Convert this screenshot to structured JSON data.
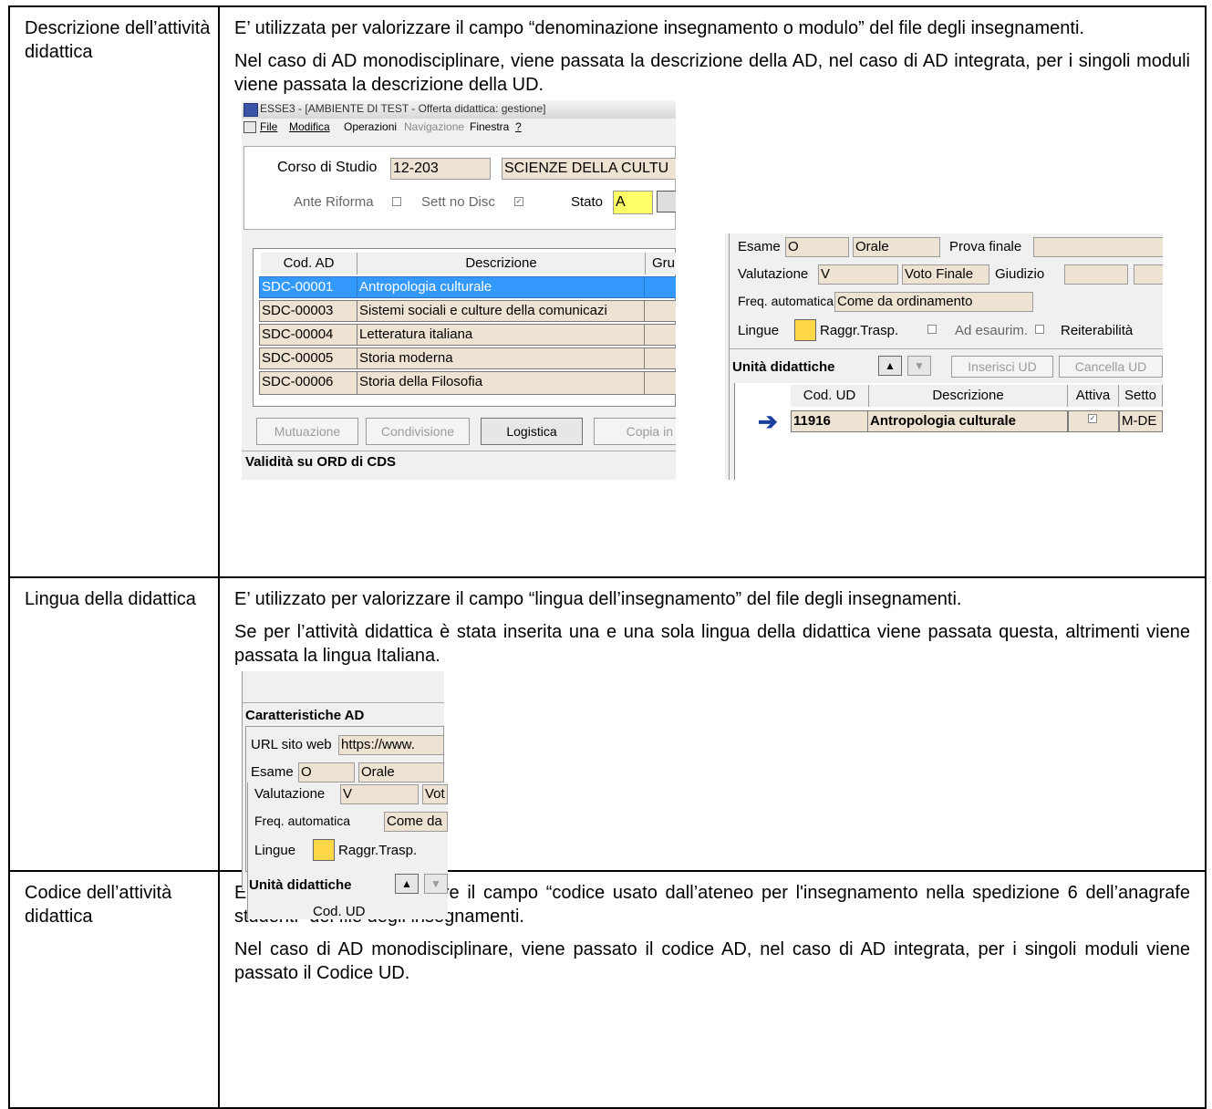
{
  "rows": [
    {
      "label": "Descrizione dell’attività didattica",
      "paragraphs": [
        "E’ utilizzata per valorizzare il campo “denominazione insegnamento o modulo” del file degli insegnamenti.",
        "Nel caso di AD monodisciplinare, viene passata la descrizione della AD, nel caso di AD integrata, per i singoli moduli viene passata la descrizione della UD."
      ]
    },
    {
      "label": "Lingua della didattica",
      "paragraphs": [
        "E’ utilizzato per valorizzare il campo “lingua dell’insegnamento” del file degli insegnamenti.",
        "Se per l’attività didattica è stata inserita una e una sola lingua della didattica viene passata questa, altrimenti viene passata la lingua Italiana."
      ]
    },
    {
      "label": "Codice dell’attività didattica",
      "paragraphs": [
        "E’ utilizzata per valorizzare il campo “codice usato dall’ateneo per l'insegnamento nella spedizione 6 dell’anagrafe studenti” del file degli insegnamenti.",
        "Nel caso di AD monodisciplinare, viene passato il codice AD, nel caso di AD integrata, per i singoli moduli viene passato il Codice UD."
      ]
    }
  ],
  "shot1": {
    "title": "ESSE3 - [AMBIENTE DI TEST - Offerta didattica: gestione]",
    "menu": [
      "File",
      "Modifica",
      "Operazioni",
      "Navigazione",
      "Finestra",
      "?"
    ],
    "corso_label": "Corso di Studio",
    "corso_code": "12-203",
    "corso_name": "SCIENZE DELLA CULTU",
    "ante_riforma": "Ante Riforma",
    "sett_no_disc": "Sett no Disc",
    "stato_label": "Stato",
    "stato_value": "A",
    "headers": [
      "Cod. AD",
      "Descrizione",
      "Gru"
    ],
    "rows": [
      {
        "code": "SDC-00001",
        "desc": "Antropologia culturale"
      },
      {
        "code": "SDC-00003",
        "desc": "Sistemi sociali e culture della comunicazi"
      },
      {
        "code": "SDC-00004",
        "desc": "Letteratura italiana"
      },
      {
        "code": "SDC-00005",
        "desc": "Storia moderna"
      },
      {
        "code": "SDC-00006",
        "desc": "Storia della Filosofia"
      }
    ],
    "buttons": [
      "Mutuazione",
      "Condivisione",
      "Logistica",
      "Copia in"
    ],
    "validita": "Validità su ORD di CDS"
  },
  "shot2": {
    "esame_label": "Esame",
    "esame_code": "O",
    "esame_desc": "Orale",
    "prova_finale": "Prova finale",
    "valutazione_label": "Valutazione",
    "valutazione_code": "V",
    "valutazione_desc": "Voto Finale",
    "giudizio": "Giudizio",
    "freq_label": "Freq. automatica",
    "freq_value": "Come da ordinamento",
    "lingue": "Lingue",
    "raggr": "Raggr.Trasp.",
    "ad_esaurim": "Ad esaurim.",
    "reiterabilita": "Reiterabilità",
    "unita_didattiche": "Unità didattiche",
    "inserisci_ud": "Inserisci UD",
    "cancella_ud": "Cancella UD",
    "headers": [
      "Cod. UD",
      "Descrizione",
      "Attiva",
      "Setto"
    ],
    "row": {
      "code": "11916",
      "desc": "Antropologia culturale",
      "settore": "M-DE"
    }
  },
  "shot3": {
    "caratteristiche": "Caratteristiche AD",
    "url_label": "URL sito web",
    "url_value": "https://www.",
    "esame_label": "Esame",
    "esame_code": "O",
    "esame_desc": "Orale",
    "valutazione_label": "Valutazione",
    "valutazione_code": "V",
    "valutazione_desc": "Vot",
    "freq_label": "Freq. automatica",
    "freq_value": "Come da",
    "lingue": "Lingue",
    "raggr": "Raggr.Trasp.",
    "unita_didattiche": "Unità didattiche",
    "col_code": "Cod. UD"
  }
}
